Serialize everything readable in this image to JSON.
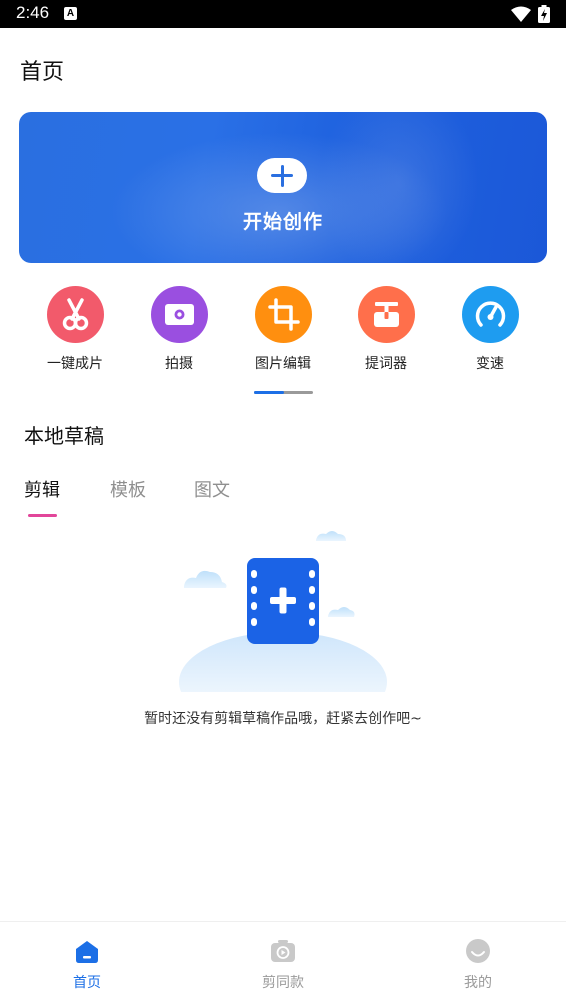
{
  "status_bar": {
    "time": "2:46",
    "notification_badge": "A"
  },
  "header": {
    "title": "首页"
  },
  "create_banner": {
    "label": "开始创作",
    "accent": "#2a6fe0"
  },
  "tools": [
    {
      "label": "一键成片",
      "icon": "scissors-icon",
      "color": "#f25a6b"
    },
    {
      "label": "拍摄",
      "icon": "camera-icon",
      "color": "#9a4fe0"
    },
    {
      "label": "图片编辑",
      "icon": "crop-icon",
      "color": "#ff8f0f"
    },
    {
      "label": "提词器",
      "icon": "teleprompter-icon",
      "color": "#ff6f4b"
    },
    {
      "label": "变速",
      "icon": "speedometer-icon",
      "color": "#1e9cf0"
    }
  ],
  "drafts": {
    "title": "本地草稿",
    "tabs": [
      {
        "label": "剪辑",
        "active": true
      },
      {
        "label": "模板",
        "active": false
      },
      {
        "label": "图文",
        "active": false
      }
    ],
    "empty_message": "暂时还没有剪辑草稿作品哦，赶紧去创作吧~"
  },
  "bottom_nav": [
    {
      "label": "首页",
      "icon": "home-icon",
      "active": true
    },
    {
      "label": "剪同款",
      "icon": "template-play-icon",
      "active": false
    },
    {
      "label": "我的",
      "icon": "profile-icon",
      "active": false
    }
  ],
  "colors": {
    "primary": "#1c6fe6",
    "tab_indicator": "#e2469a"
  }
}
